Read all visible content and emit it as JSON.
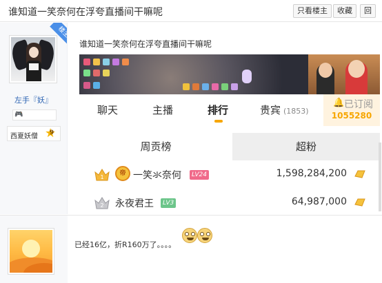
{
  "header": {
    "title": "谁知道一笑奈何在浮夸直播间干嘛呢",
    "only_owner_label": "只看楼主",
    "favorite_label": "收藏",
    "reply_label": "回"
  },
  "post1": {
    "author": {
      "corner_badge": "楼主",
      "username": "左手『妖』",
      "level_name": "西夏妖僧",
      "level_num": "9"
    },
    "share_title": "谁知道一笑奈何在浮夸直播间干嘛呢",
    "stream": {
      "tabs": [
        {
          "label": "聊天"
        },
        {
          "label": "主播"
        },
        {
          "label": "排行"
        },
        {
          "label": "贵宾",
          "count": "(1853)"
        }
      ],
      "active_tab": "排行",
      "subscribe_label": "已订阅",
      "subscribe_count": "1055280"
    },
    "ranking": {
      "tabs": [
        "周贡榜",
        "超粉"
      ],
      "rows": [
        {
          "rank": "1",
          "medal": "帝",
          "name": "一笑氺奈何",
          "level": "LV24",
          "score": "1,598,284,200"
        },
        {
          "rank": "2",
          "name": "永夜君王",
          "level": "LV3",
          "score": "64,987,000"
        }
      ]
    }
  },
  "post2": {
    "text": "已经16亿，折R160万了。。。。"
  },
  "colors": {
    "accent_orange": "#f7a600",
    "username_blue": "#2d64b3",
    "badge_blue": "#4a8fe8",
    "lv_pink": "#f06a8a",
    "lv_green": "#6cc58a"
  },
  "icons": [
    "gamepad-icon",
    "star-icon",
    "bell-icon",
    "crown-icon",
    "gem-icon",
    "emoji-icon"
  ]
}
